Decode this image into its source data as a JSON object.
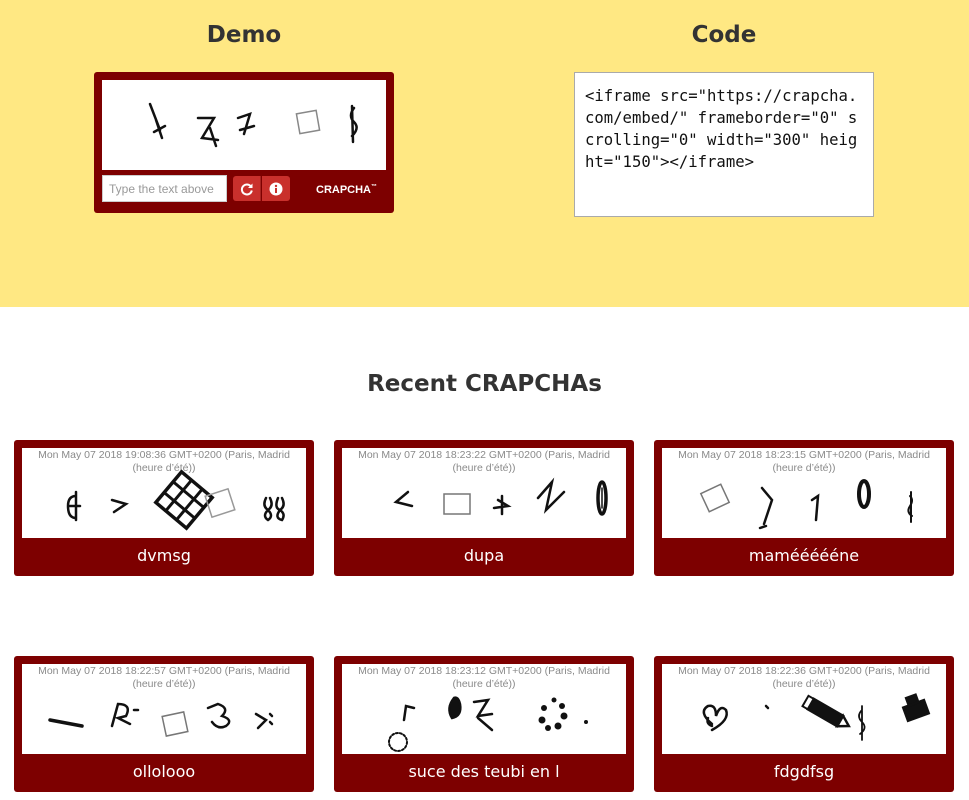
{
  "demo": {
    "title": "Demo",
    "input_placeholder": "Type the text above",
    "brand": "CRAPCHA",
    "brand_tm": "™",
    "refresh_icon": "refresh-icon",
    "info_icon": "info-icon"
  },
  "code": {
    "title": "Code",
    "snippet": "<iframe src=\"https://crapcha.com/embed/\" frameborder=\"0\" scrolling=\"0\" width=\"300\" height=\"150\"></iframe>"
  },
  "recent": {
    "title": "Recent CRAPCHAs",
    "items": [
      {
        "timestamp": "Mon May 07 2018 19:08:36 GMT+0200 (Paris, Madrid (heure d’été))",
        "label": "dvmsg"
      },
      {
        "timestamp": "Mon May 07 2018 18:23:22 GMT+0200 (Paris, Madrid (heure d’été))",
        "label": "dupa"
      },
      {
        "timestamp": "Mon May 07 2018 18:23:15 GMT+0200 (Paris, Madrid (heure d’été))",
        "label": "maméééééne"
      },
      {
        "timestamp": "Mon May 07 2018 18:22:57 GMT+0200 (Paris, Madrid (heure d’été))",
        "label": "ollolooo"
      },
      {
        "timestamp": "Mon May 07 2018 18:23:12 GMT+0200 (Paris, Madrid (heure d’été))",
        "label": "suce des teubi en l"
      },
      {
        "timestamp": "Mon May 07 2018 18:22:36 GMT+0200 (Paris, Madrid (heure d’été))",
        "label": "fdgdfsg"
      }
    ]
  },
  "colors": {
    "banner": "#ffe883",
    "card": "#7d0000",
    "button": "#c9302c"
  }
}
